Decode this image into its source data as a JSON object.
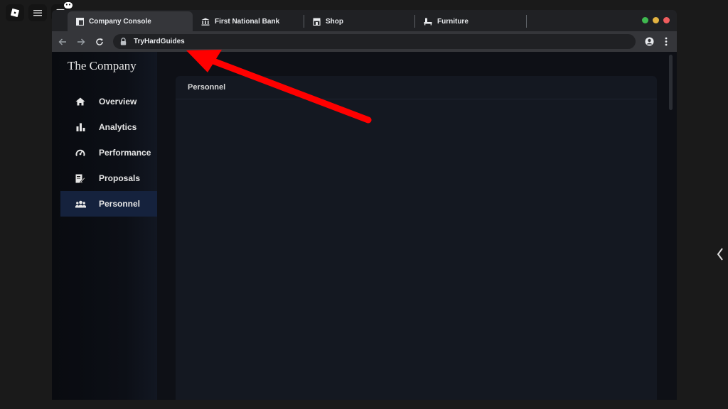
{
  "browser": {
    "tabs": [
      {
        "label": "Company Console",
        "icon": "dashboard-icon",
        "active": true
      },
      {
        "label": "First National Bank",
        "icon": "bank-icon",
        "active": false
      },
      {
        "label": "Shop",
        "icon": "store-icon",
        "active": false
      },
      {
        "label": "Furniture",
        "icon": "furniture-icon",
        "active": false
      }
    ],
    "address": "TryHardGuides",
    "window_controls": [
      "#3fb950",
      "#e3b341",
      "#f05d5e"
    ]
  },
  "app": {
    "brand": "The Company",
    "nav": [
      {
        "label": "Overview",
        "icon": "home-icon",
        "active": false
      },
      {
        "label": "Analytics",
        "icon": "bar-chart-icon",
        "active": false
      },
      {
        "label": "Performance",
        "icon": "speedometer-icon",
        "active": false
      },
      {
        "label": "Proposals",
        "icon": "document-edit-icon",
        "active": false
      },
      {
        "label": "Personnel",
        "icon": "users-icon",
        "active": true
      }
    ],
    "panel_title": "Personnel"
  },
  "colors": {
    "accent_active_nav": "#15223d",
    "annotation_arrow": "#ff0000"
  }
}
